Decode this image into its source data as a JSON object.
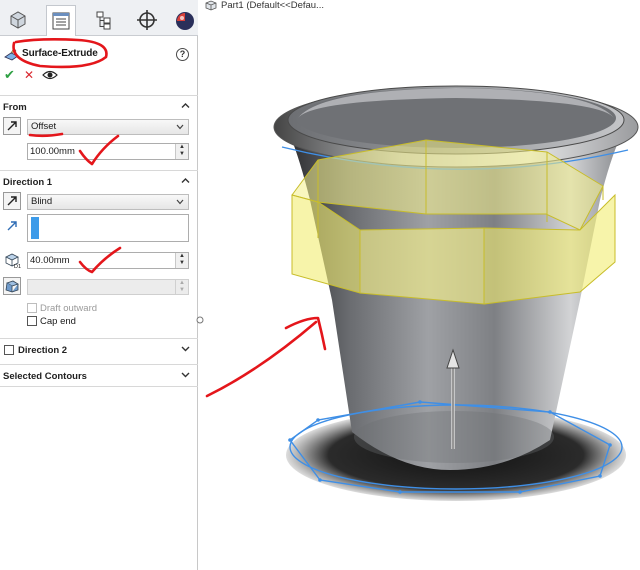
{
  "tabs": [
    {
      "name": "featuremanager-tab",
      "icon": "feature-tree-icon"
    },
    {
      "name": "propertymanager-tab",
      "icon": "property-manager-icon",
      "active": true
    },
    {
      "name": "configurationmanager-tab",
      "icon": "configuration-icon"
    },
    {
      "name": "dimxpert-tab",
      "icon": "crosshair-icon"
    },
    {
      "name": "display-manager-tab",
      "icon": "appearance-sphere-icon"
    }
  ],
  "feature": {
    "title": "Surface-Extrude",
    "help": "?",
    "ok": "✔",
    "cancel": "✕"
  },
  "from": {
    "header": "From",
    "type": "Offset",
    "offset_value": "100.00mm"
  },
  "direction1": {
    "header": "Direction 1",
    "end_condition": "Blind",
    "depth": "40.00mm",
    "draft_outward": "Draft outward",
    "cap_end": "Cap end"
  },
  "direction2": {
    "header": "Direction 2"
  },
  "selected_contours": {
    "header": "Selected Contours"
  },
  "viewport": {
    "breadcrumb": "Part1  (Default<<Defau..."
  },
  "colors": {
    "accent_blue": "#3d9be9",
    "preview_yellow": "#f4f08a",
    "sketch_blue": "#3f8fe6",
    "annotation_red": "#e4161b"
  }
}
